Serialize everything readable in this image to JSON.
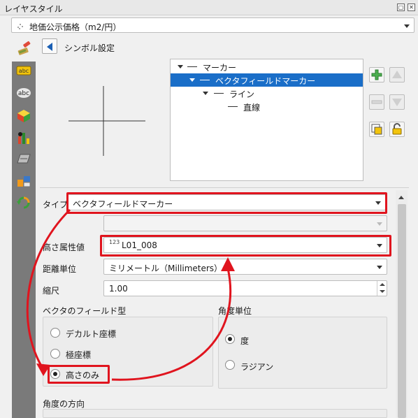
{
  "window": {
    "title": "レイヤスタイル",
    "btn_float": "▢",
    "btn_close": "✕"
  },
  "layer_combo": {
    "value": "地価公示価格（m2/円）"
  },
  "symbol_panel": {
    "title": "シンボル設定"
  },
  "tree": {
    "items": [
      {
        "label": "マーカー",
        "level": 0
      },
      {
        "label": "ベクタフィールドマーカー",
        "level": 1,
        "selected": true
      },
      {
        "label": "ライン",
        "level": 2
      },
      {
        "label": "直線",
        "level": 3
      }
    ]
  },
  "form": {
    "type_label": "タイプ",
    "type_value": "ベクタフィールドマーカー",
    "height_attr_label": "高さ属性値",
    "height_attr_prefix": "123",
    "height_attr_value": "L01_008",
    "distance_unit_label": "距離単位",
    "distance_unit_value": "ミリメートル（Millimeters）",
    "scale_label": "縮尺",
    "scale_value": "1.00"
  },
  "vector_field_type": {
    "title": "ベクタのフィールド型",
    "options": [
      "デカルト座標",
      "極座標",
      "高さのみ"
    ],
    "selected_index": 2
  },
  "angle_unit": {
    "title": "角度単位",
    "options": [
      "度",
      "ラジアン"
    ],
    "selected_index": 0
  },
  "angle_direction": {
    "title": "角度の方向"
  },
  "colors": {
    "accent": "#1a6ec8",
    "annotation": "#e0141e"
  },
  "icons": [
    "dots-icon",
    "paintbrush-icon",
    "back-arrow-icon",
    "add-icon",
    "remove-icon",
    "move-up-icon",
    "move-down-icon",
    "duplicate-icon",
    "lock-icon"
  ]
}
